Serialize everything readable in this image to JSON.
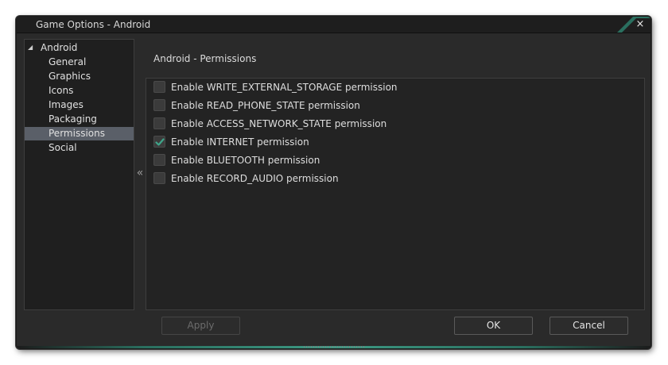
{
  "window": {
    "title": "Game Options - Android",
    "close_glyph": "×"
  },
  "sidebar": {
    "root": {
      "label": "Android",
      "arrow_glyph": "◢"
    },
    "items": [
      {
        "label": "General",
        "selected": false
      },
      {
        "label": "Graphics",
        "selected": false
      },
      {
        "label": "Icons",
        "selected": false
      },
      {
        "label": "Images",
        "selected": false
      },
      {
        "label": "Packaging",
        "selected": false
      },
      {
        "label": "Permissions",
        "selected": true
      },
      {
        "label": "Social",
        "selected": false
      }
    ],
    "collapse_glyph": "«"
  },
  "main": {
    "title": "Android - Permissions",
    "permissions": [
      {
        "label": "Enable WRITE_EXTERNAL_STORAGE permission",
        "checked": false
      },
      {
        "label": "Enable READ_PHONE_STATE permission",
        "checked": false
      },
      {
        "label": "Enable ACCESS_NETWORK_STATE permission",
        "checked": false
      },
      {
        "label": "Enable INTERNET permission",
        "checked": true
      },
      {
        "label": "Enable BLUETOOTH permission",
        "checked": false
      },
      {
        "label": "Enable RECORD_AUDIO permission",
        "checked": false
      }
    ]
  },
  "buttons": {
    "apply": "Apply",
    "ok": "OK",
    "cancel": "Cancel"
  },
  "colors": {
    "accent": "#3d9b85",
    "check": "#3fa58a",
    "selection": "#5a5f68"
  },
  "icons": {
    "close": "close-icon",
    "tree_arrow": "tree-expanded-icon",
    "collapse": "double-chevron-left-icon",
    "check": "checkmark-icon"
  }
}
